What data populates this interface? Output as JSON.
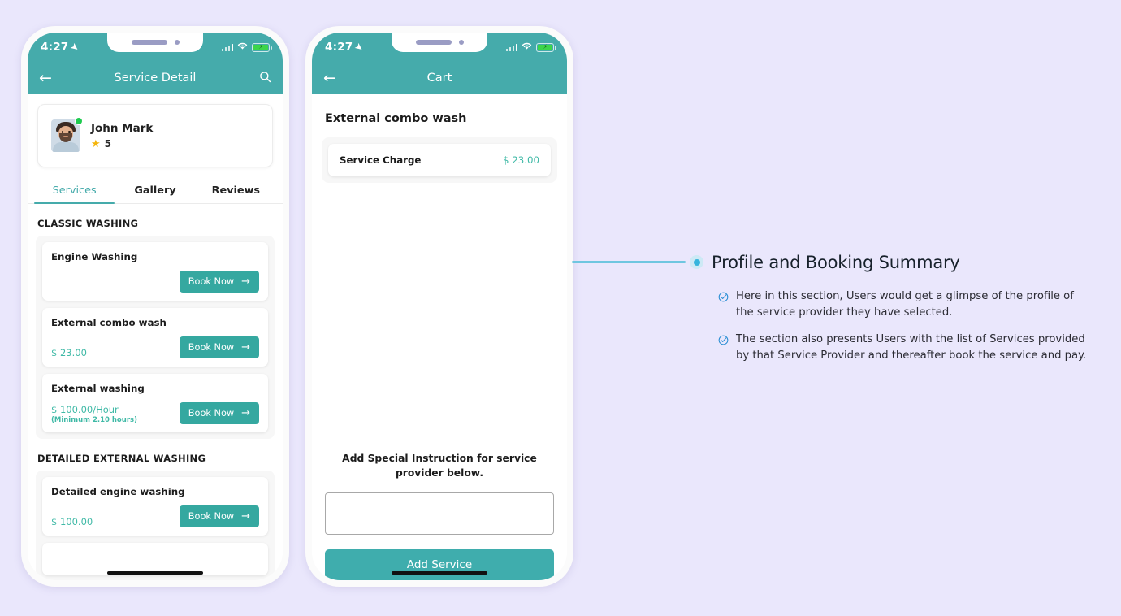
{
  "status_bar": {
    "time": "4:27",
    "icons": [
      "location-arrow-icon",
      "signal-bars-icon",
      "wifi-icon",
      "battery-charging-icon"
    ]
  },
  "phone_one": {
    "nav": {
      "back_icon": "arrow-left-icon",
      "title": "Service Detail",
      "search_icon": "search-icon"
    },
    "profile": {
      "name": "John Mark",
      "rating": "5",
      "star_icon": "star-icon",
      "online_status": "online"
    },
    "tabs": [
      {
        "label": "Services",
        "active": true
      },
      {
        "label": "Gallery",
        "active": false
      },
      {
        "label": "Reviews",
        "active": false
      }
    ],
    "sections": [
      {
        "label": "CLASSIC WASHING",
        "services": [
          {
            "name": "Engine Washing",
            "price": "",
            "sub": "",
            "button": "Book Now"
          },
          {
            "name": "External combo wash",
            "price": "$ 23.00",
            "sub": "",
            "button": "Book Now"
          },
          {
            "name": "External washing",
            "price": "$ 100.00/Hour",
            "sub": "(Minimum 2.10 hours)",
            "button": "Book Now"
          }
        ]
      },
      {
        "label": "DETAILED EXTERNAL WASHING",
        "services": [
          {
            "name": "Detailed engine washing",
            "price": "$ 100.00",
            "sub": "",
            "button": "Book Now"
          }
        ]
      }
    ]
  },
  "phone_two": {
    "nav": {
      "back_icon": "arrow-left-icon",
      "title": "Cart"
    },
    "cart_title": "External combo wash",
    "line_items": [
      {
        "label": "Service Charge",
        "price": "$ 23.00"
      }
    ],
    "instruction_label": "Add Special Instruction for service provider below.",
    "instruction_value": "",
    "instruction_placeholder": "",
    "add_button": "Add Service"
  },
  "annotation": {
    "title": "Profile and Booking Summary",
    "bullets": [
      "Here in this section, Users would get a glimpse of the profile of the service provider they have selected.",
      "The section also presents Users with the list of Services provided by that Service Provider and thereafter book the service and pay."
    ],
    "bullet_icon": "circle-check-icon"
  },
  "colors": {
    "background": "#eae7fc",
    "teal_header": "#45abab",
    "teal_accent": "#3fb9a6",
    "button_teal": "#35a8a0",
    "connector_blue": "#6fc6e0",
    "dot_blue": "#35b4dd",
    "online_green": "#1ecb4f",
    "star_yellow": "#f5b50a"
  }
}
